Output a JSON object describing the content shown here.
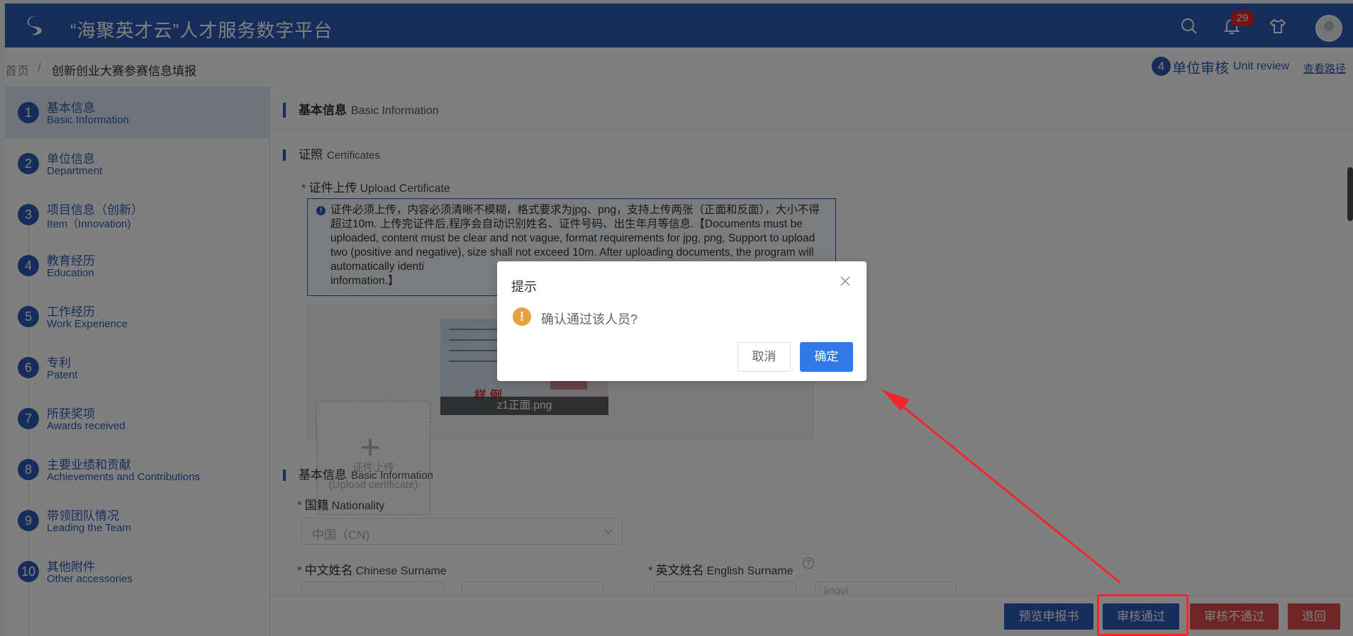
{
  "header": {
    "brand": "“海聚英才云”人才服务数字平台",
    "notification_count": "29",
    "icons": [
      "search-icon",
      "bell-icon",
      "shirt-icon",
      "user-avatar"
    ]
  },
  "breadcrumb": {
    "home": "首页",
    "separator": "/",
    "current": "创新创业大赛参赛信息填报",
    "step_number": "4",
    "step_label": "单位审核",
    "step_label_en": "Unit review",
    "view_path": "查看路径"
  },
  "sidebar": {
    "items": [
      {
        "num": "1",
        "cn": "基本信息",
        "en": "Basic Information"
      },
      {
        "num": "2",
        "cn": "单位信息",
        "en": "Department"
      },
      {
        "num": "3",
        "cn": "项目信息（创新）",
        "en": "Item（Innovation)"
      },
      {
        "num": "4",
        "cn": "教育经历",
        "en": "Education"
      },
      {
        "num": "5",
        "cn": "工作经历",
        "en": "Work Experience"
      },
      {
        "num": "6",
        "cn": "专利",
        "en": "Patent"
      },
      {
        "num": "7",
        "cn": "所获奖项",
        "en": "Awards received"
      },
      {
        "num": "8",
        "cn": "主要业绩和贡献",
        "en": "Achievements and Contributions"
      },
      {
        "num": "9",
        "cn": "带领团队情况",
        "en": "Leading the Team"
      },
      {
        "num": "10",
        "cn": "其他附件",
        "en": "Other accessories"
      }
    ]
  },
  "main": {
    "section_title": "基本信息",
    "section_title_en": "Basic Information",
    "certificates": {
      "title": "证照",
      "title_en": "Certificates"
    },
    "upload_label": "证件上传",
    "upload_label_en": "Upload Certificate",
    "notice": "证件必须上传，内容必须清晰不模糊，格式要求为jpg、png，支持上传两张（正面和反面），大小不得超过10m. 上传完证件后,程序会自动识别姓名、证件号码、出生年月等信息.【Documents must be uploaded, content must be clear and not vague, format requirements for jpg, png, Support to upload two (positive and negative), size shall not exceed 10m. After uploading documents, the program will automatically identi",
    "notice_tail": "information.】",
    "upload_box_cn": "证件上传",
    "upload_box_en": "(Upload certificate)",
    "thumb_stamp": "样 例",
    "thumb_caption": "z1正面.png",
    "basic_info": {
      "title": "基本信息",
      "title_en": "Basic Information"
    },
    "nationality_label": "国籍",
    "nationality_label_en": "Nationality",
    "nationality_value": "中国（CN)",
    "cn_surname_label": "中文姓名",
    "cn_surname_label_en": "Chinese Surname",
    "en_surname_label": "英文姓名",
    "en_surname_label_en": "English Surname",
    "en_given_value": "lingyi"
  },
  "bottom": {
    "preview": "预览申报书",
    "approve": "审核通过",
    "reject": "审核不通过",
    "return": "退回"
  },
  "dialog": {
    "title": "提示",
    "message": "确认通过该人员?",
    "cancel": "取消",
    "confirm": "确定"
  },
  "colors": {
    "primary": "#2d5bb6",
    "danger": "#e04b4b",
    "warning": "#e6a23c",
    "confirm": "#2f7ae5",
    "annotation": "#f4262b"
  }
}
